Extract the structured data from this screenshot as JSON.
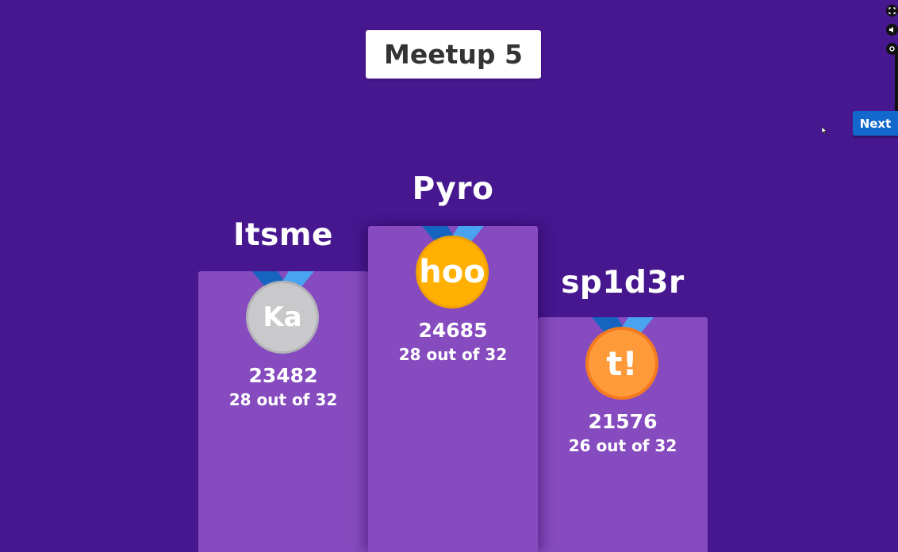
{
  "header": {
    "title": "Meetup 5"
  },
  "controls": {
    "next_label": "Next",
    "side_icons": [
      "fullscreen-icon",
      "volume-icon",
      "settings-icon"
    ]
  },
  "podium": {
    "first": {
      "name": "Pyro",
      "medal_text": "hoo",
      "score": "24685",
      "correct": "28 out of 32",
      "medal_color": "#ffb000"
    },
    "second": {
      "name": "Itsme",
      "medal_text": "Ka",
      "score": "23482",
      "correct": "28 out of 32",
      "medal_color": "#c9c9cc"
    },
    "third": {
      "name": "sp1d3r",
      "medal_text": "t!",
      "score": "21576",
      "correct": "26 out of 32",
      "medal_color": "#ff9a3a"
    }
  },
  "colors": {
    "background": "#46178f",
    "podium": "#864cbf",
    "next_button": "#1368ce",
    "ribbon_dark": "#1565c0",
    "ribbon_light": "#4aa3f0"
  }
}
